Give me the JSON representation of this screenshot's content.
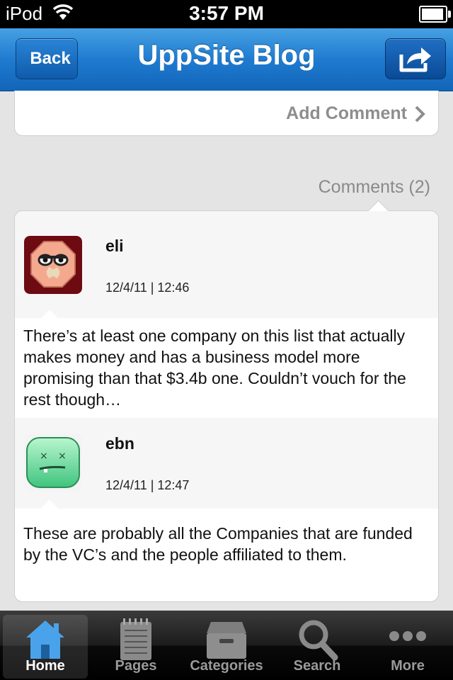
{
  "status_bar": {
    "carrier": "iPod",
    "time": "3:57 PM"
  },
  "navbar": {
    "title": "UppSite Blog",
    "back_label": "Back"
  },
  "post": {
    "add_comment_label": "Add Comment"
  },
  "comments": {
    "header": "Comments (2)",
    "items": [
      {
        "author": "eli",
        "date": "12/4/11 | 12:46",
        "text": "There’s at least one company on this list that actually makes money and has a business model more promising than that $3.4b one. Couldn’t vouch for the rest though…"
      },
      {
        "author": "ebn",
        "date": "12/4/11 | 12:47",
        "text": "These are probably all the Companies that are funded by the VC’s and the people affiliated to them."
      }
    ]
  },
  "tabbar": {
    "items": [
      {
        "label": "Home",
        "icon": "home-icon",
        "active": true
      },
      {
        "label": "Pages",
        "icon": "notepad-icon"
      },
      {
        "label": "Categories",
        "icon": "archive-box-icon"
      },
      {
        "label": "Search",
        "icon": "magnifier-icon"
      },
      {
        "label": "More",
        "icon": "more-dots-icon"
      }
    ]
  },
  "colors": {
    "nav_blue": "#1f7bd0",
    "tab_active_blue": "#4aa3ea"
  }
}
